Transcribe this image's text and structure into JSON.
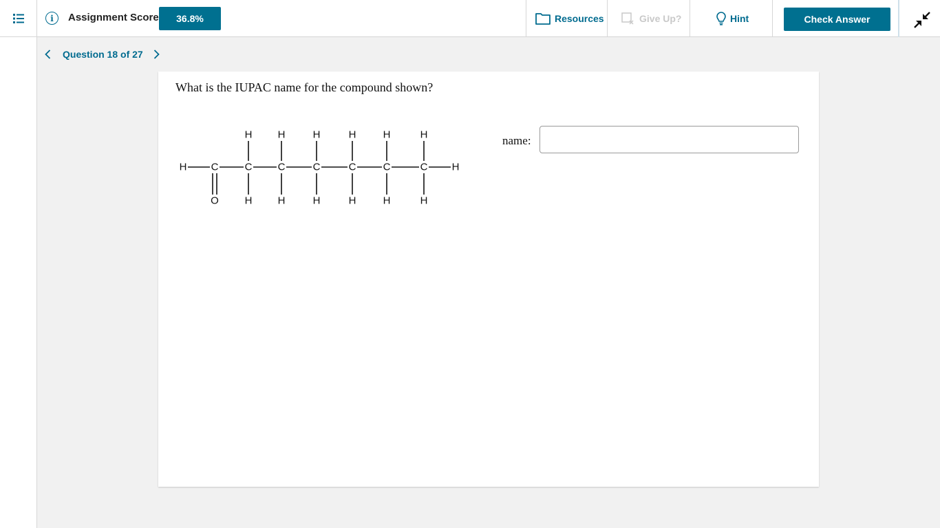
{
  "header": {
    "score_label": "Assignment Score:",
    "score_value": "36.8%",
    "resources_label": "Resources",
    "giveup_label": "Give Up?",
    "hint_label": "Hint",
    "check_answer_label": "Check Answer"
  },
  "nav": {
    "question_label": "Question 18 of 27"
  },
  "question": {
    "prompt": "What is the IUPAC name for the compound shown?",
    "answer_label": "name:",
    "answer_value": ""
  },
  "molecule": {
    "backbone": [
      "H",
      "C",
      "C",
      "C",
      "C",
      "C",
      "C",
      "C",
      "H"
    ],
    "top_substituents": [
      "",
      "H",
      "H",
      "H",
      "H",
      "H",
      "H"
    ],
    "bottom_substituents": [
      "O",
      "H",
      "H",
      "H",
      "H",
      "H",
      "H"
    ],
    "bottom_bond_types": [
      "double",
      "single",
      "single",
      "single",
      "single",
      "single",
      "single"
    ]
  },
  "colors": {
    "accent": "#007090",
    "link": "#006b8f",
    "disabled": "#c9c9c9"
  },
  "icons": {
    "menu": "list-icon",
    "info": "info-icon",
    "resources": "folder-icon",
    "giveup": "give-up-icon",
    "hint": "lightbulb-icon",
    "collapse": "collapse-icon"
  }
}
